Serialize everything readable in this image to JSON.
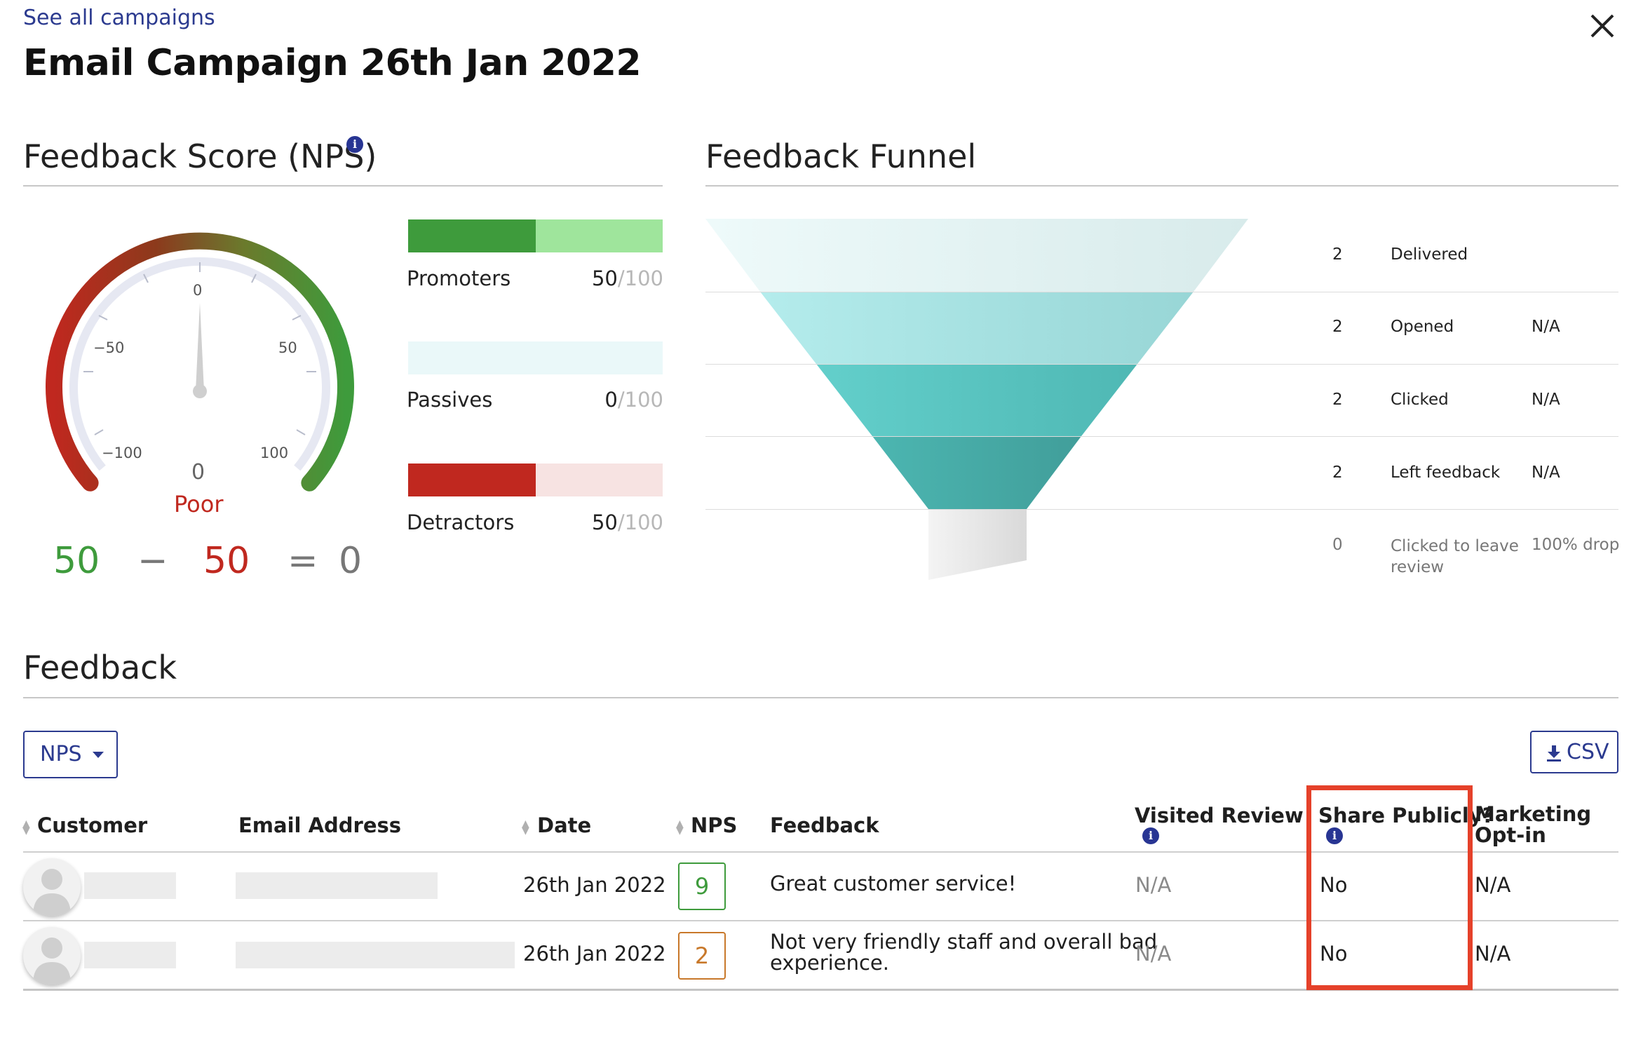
{
  "header": {
    "back_link": "See all campaigns",
    "title": "Email Campaign 26th Jan 2022"
  },
  "nps_section": {
    "title": "Feedback Score (NPS)",
    "gauge": {
      "ticks": [
        "0",
        "−50",
        "50",
        "−100",
        "100"
      ],
      "value": "0",
      "rating": "Poor",
      "needle_value": 0
    },
    "bars": [
      {
        "label": "Promoters",
        "count": "50",
        "denominator": "/100",
        "fraction": 0.5,
        "fill": "#3e9b3c",
        "track": "#9fe59c"
      },
      {
        "label": "Passives",
        "count": "0",
        "denominator": "/100",
        "fraction": 0.0,
        "fill": "#7fc9d6",
        "track": "#eaf8f9"
      },
      {
        "label": "Detractors",
        "count": "50",
        "denominator": "/100",
        "fraction": 0.5,
        "fill": "#c0281f",
        "track": "#f7e3e2"
      }
    ],
    "equation": {
      "promoters": "50",
      "minus": "−",
      "detractors": "50",
      "equals": "=",
      "result": "0"
    },
    "colors": {
      "good": "#3e9b3c",
      "bad": "#c0281f",
      "neutral": "#777777"
    }
  },
  "funnel_section": {
    "title": "Feedback Funnel",
    "stages": [
      {
        "count": "2",
        "label": "Delivered",
        "rate": ""
      },
      {
        "count": "2",
        "label": "Opened",
        "rate": "N/A"
      },
      {
        "count": "2",
        "label": "Clicked",
        "rate": "N/A"
      },
      {
        "count": "2",
        "label": "Left feedback",
        "rate": "N/A"
      },
      {
        "count": "0",
        "label": "Clicked to leave review",
        "rate": "100% drop"
      }
    ]
  },
  "feedback_section": {
    "title": "Feedback",
    "filter_button": "NPS",
    "csv_button": "CSV",
    "columns": {
      "customer": "Customer",
      "email": "Email Address",
      "date": "Date",
      "nps": "NPS",
      "feedback": "Feedback",
      "visited": "Visited Review Site",
      "share": "Share Publicly?",
      "marketing_line1": "Marketing",
      "marketing_line2": "Opt-in"
    },
    "rows": [
      {
        "date": "26th Jan 2022",
        "nps": "9",
        "nps_color": "#3e9b3c",
        "feedback_line1": "Great customer service!",
        "feedback_line2": "",
        "visited": "N/A",
        "share": "No",
        "marketing": "N/A"
      },
      {
        "date": "26th Jan 2022",
        "nps": "2",
        "nps_color": "#c8782a",
        "feedback_line1": "Not very friendly staff and overall bad",
        "feedback_line2": "experience.",
        "visited": "N/A",
        "share": "No",
        "marketing": "N/A"
      }
    ]
  }
}
